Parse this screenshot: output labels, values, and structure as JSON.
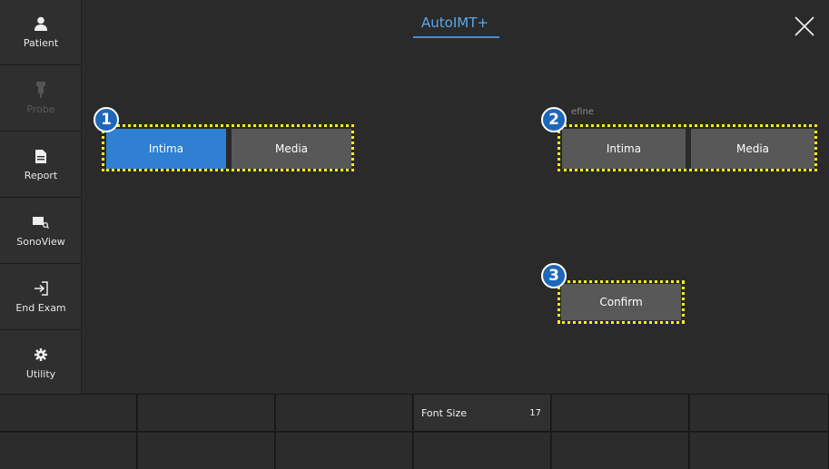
{
  "sidebar": {
    "items": [
      {
        "label": "Patient",
        "icon": "user-icon",
        "enabled": true
      },
      {
        "label": "Probe",
        "icon": "probe-icon",
        "enabled": false
      },
      {
        "label": "Report",
        "icon": "document-icon",
        "enabled": true
      },
      {
        "label": "SonoView",
        "icon": "image-search-icon",
        "enabled": true
      },
      {
        "label": "End Exam",
        "icon": "exit-icon",
        "enabled": true
      },
      {
        "label": "Utility",
        "icon": "gear-icon",
        "enabled": true
      }
    ]
  },
  "header": {
    "title": "AutoIMT+",
    "close_icon": "close-icon"
  },
  "left_group": {
    "label": "",
    "badge": "1",
    "buttons": [
      {
        "label": "Intima",
        "selected": true
      },
      {
        "label": "Media",
        "selected": false
      }
    ]
  },
  "right_group": {
    "label": "efine",
    "badge": "2",
    "buttons": [
      {
        "label": "Intima",
        "selected": false
      },
      {
        "label": "Media",
        "selected": false
      }
    ]
  },
  "confirm": {
    "badge": "3",
    "label": "Confirm"
  },
  "bottom_bar": {
    "font_size_label": "Font Size",
    "font_size_value": "17"
  },
  "colors": {
    "accent": "#2f7fd2",
    "highlight": "#f4ef1a",
    "title": "#5aa8ee"
  }
}
